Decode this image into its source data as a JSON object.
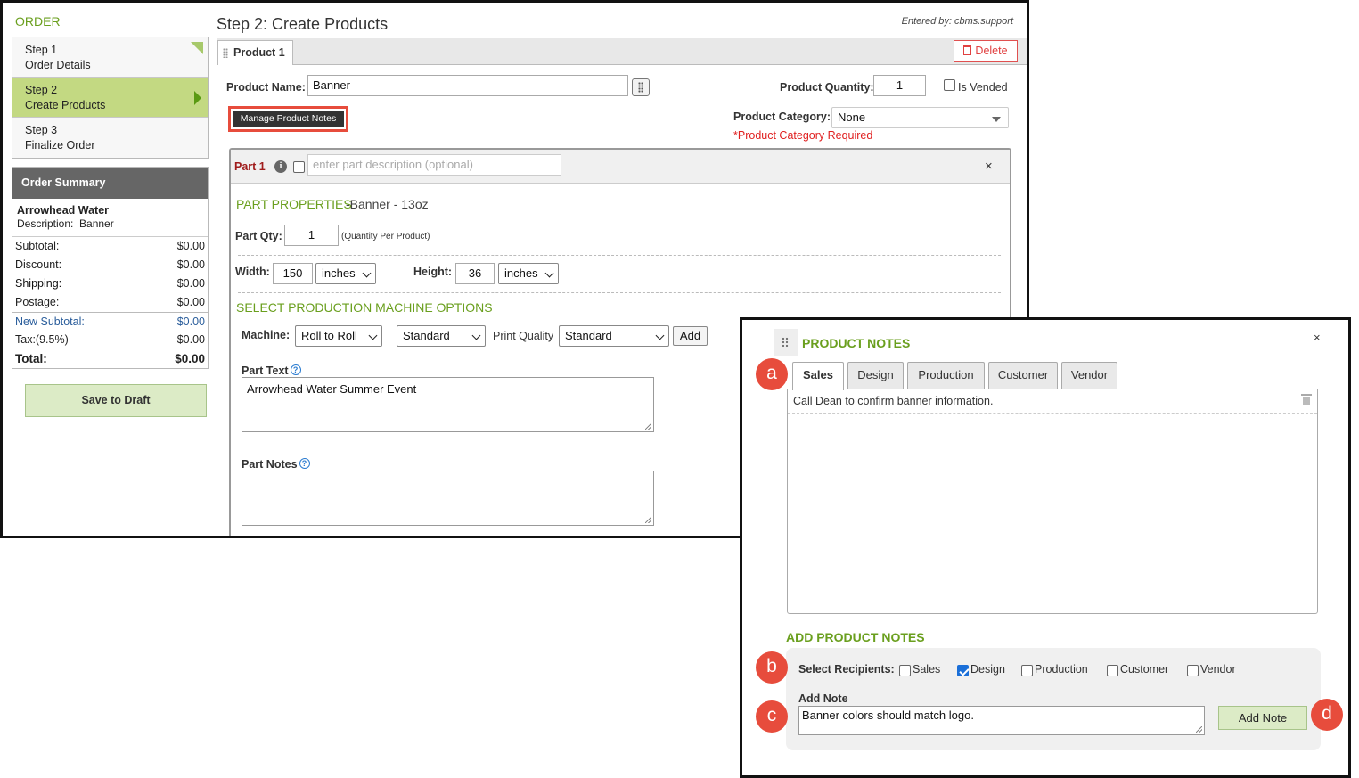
{
  "sidebar": {
    "title": "ORDER",
    "steps": [
      {
        "num": "Step 1",
        "label": "Order Details"
      },
      {
        "num": "Step 2",
        "label": "Create Products"
      },
      {
        "num": "Step 3",
        "label": "Finalize Order"
      }
    ],
    "summary": {
      "title": "Order Summary",
      "customer": "Arrowhead Water",
      "description": "Description:  Banner",
      "rows": [
        {
          "label": "Subtotal:",
          "value": "$0.00"
        },
        {
          "label": "Discount:",
          "value": "$0.00"
        },
        {
          "label": "Shipping:",
          "value": "$0.00"
        },
        {
          "label": "Postage:",
          "value": "$0.00"
        },
        {
          "label": "New Subtotal:",
          "value": "$0.00"
        },
        {
          "label": "Tax:(9.5%)",
          "value": "$0.00"
        },
        {
          "label": "Total:",
          "value": "$0.00"
        }
      ]
    },
    "save_label": "Save to Draft"
  },
  "header": {
    "title": "Step 2: Create Products",
    "entered_by": "Entered by: cbms.support"
  },
  "product": {
    "tab_label": "Product 1",
    "delete_label": "Delete",
    "name_label": "Product Name:",
    "name_value": "Banner",
    "quantity_label": "Product Quantity:",
    "quantity_value": "1",
    "vended_label": "Is Vended",
    "manage_notes_label": "Manage Product Notes",
    "category_label": "Product Category:",
    "category_value": "None",
    "category_error": "*Product Category Required"
  },
  "part": {
    "title": "Part 1",
    "description_placeholder": "enter part description (optional)",
    "close": "×",
    "properties_title": "PART PROPERTIES",
    "properties_sub": "-Banner - 13oz",
    "qty_label": "Part Qty:",
    "qty_value": "1",
    "qty_hint": "(Quantity Per Product)",
    "width_label": "Width:",
    "width_value": "150",
    "width_unit": "inches",
    "height_label": "Height:",
    "height_value": "36",
    "height_unit": "inches",
    "machine_title": "SELECT PRODUCTION MACHINE OPTIONS",
    "machine_label": "Machine:",
    "machine_value": "Roll to Roll",
    "mode_value": "Standard",
    "quality_label": "Print Quality",
    "quality_value": "Standard",
    "add_label": "Add",
    "text_label": "Part Text",
    "text_value": "Arrowhead Water Summer Event",
    "notes_label": "Part Notes",
    "notes_value": "",
    "help_glyph": "?"
  },
  "notes_dialog": {
    "title": "PRODUCT NOTES",
    "close": "×",
    "tabs": [
      "Sales",
      "Design",
      "Production",
      "Customer",
      "Vendor"
    ],
    "active_tab": "Sales",
    "notes": [
      "Call Dean to confirm banner information."
    ],
    "add_title": "ADD PRODUCT NOTES",
    "recipients_label": "Select Recipients:",
    "recipients": [
      {
        "label": "Sales",
        "checked": false
      },
      {
        "label": "Design",
        "checked": true
      },
      {
        "label": "Production",
        "checked": false
      },
      {
        "label": "Customer",
        "checked": false
      },
      {
        "label": "Vendor",
        "checked": false
      }
    ],
    "add_note_label": "Add Note",
    "add_note_value": "Banner colors should match logo.",
    "add_button": "Add Note"
  },
  "markers": [
    "a",
    "b",
    "c",
    "d"
  ],
  "colors": {
    "accent_green": "#6a9f1e",
    "active_step": "#c3d982",
    "error_red": "#e02020",
    "marker_red": "#e74c3c",
    "link_blue": "#2a5d9b"
  }
}
